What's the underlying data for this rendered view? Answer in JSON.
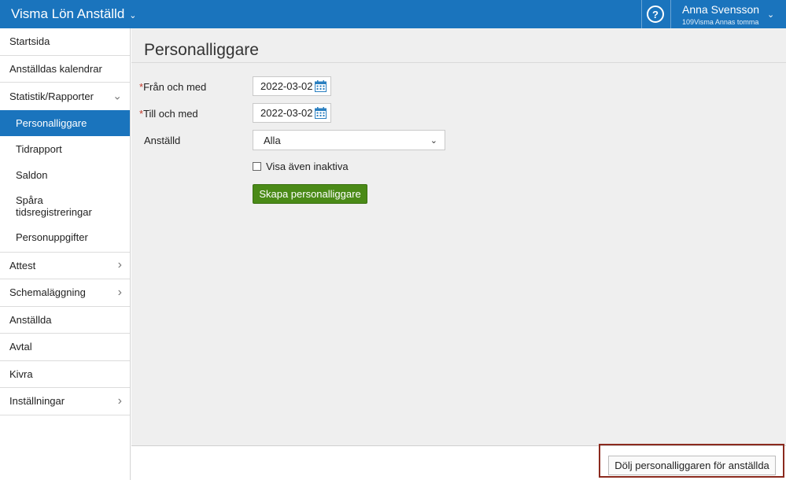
{
  "app": {
    "title": "Visma Lön Anställd",
    "chevron": "⌄",
    "help_label": "?",
    "user_name": "Anna Svensson",
    "user_org": "109Visma Annas tomma",
    "user_chevron": "⌄",
    "brand_color": "#1a74bd"
  },
  "sidebar": {
    "items": [
      {
        "label": "Startsida"
      },
      {
        "label": "Anställdas kalendrar"
      },
      {
        "label": "Statistik/Rapporter",
        "arrow": "⌄"
      },
      {
        "label": "Attest",
        "arrow": "›"
      },
      {
        "label": "Schemaläggning",
        "arrow": "›"
      },
      {
        "label": "Anställda"
      },
      {
        "label": "Avtal"
      },
      {
        "label": "Kivra"
      },
      {
        "label": "Inställningar",
        "arrow": "›"
      }
    ],
    "subitems": [
      {
        "label": "Personalliggare",
        "active": true
      },
      {
        "label": "Tidrapport"
      },
      {
        "label": "Saldon"
      },
      {
        "label": "Spåra tidsregistreringar"
      },
      {
        "label": "Personuppgifter"
      }
    ]
  },
  "main": {
    "title": "Personalliggare",
    "form": {
      "required_mark": "*",
      "from_label": "Från och med",
      "from_value": "2022-03-02",
      "to_label": "Till och med",
      "to_value": "2022-03-02",
      "employee_label": "Anställd",
      "employee_value": "Alla",
      "employee_chevron": "⌄",
      "inactive_label": "Visa även inaktiva",
      "inactive_checked": false,
      "create_button": "Skapa personalliggare"
    },
    "footer": {
      "hide_button": "Dölj personalliggaren för anställda"
    }
  },
  "colors": {
    "primary_button": "#4a8a17",
    "active_nav": "#1a74bd",
    "required": "#c0392b",
    "highlight_border": "#8b2a1e"
  }
}
